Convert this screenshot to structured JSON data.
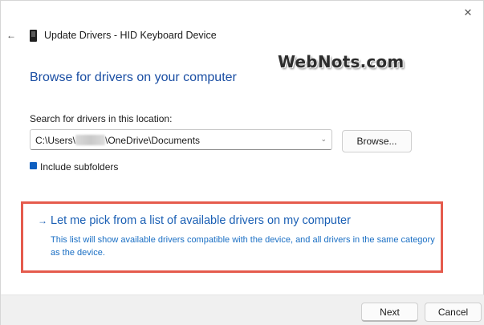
{
  "window": {
    "title": "Update Drivers - HID Keyboard Device",
    "close_glyph": "✕",
    "back_glyph": "←",
    "device_icon": "keyboard-device-icon"
  },
  "watermark": "WebNots.com",
  "main": {
    "heading": "Browse for drivers on your computer",
    "search_label": "Search for drivers in this location:",
    "path_prefix": "C:\\Users\\",
    "path_suffix": "\\OneDrive\\Documents",
    "browse_label": "Browse...",
    "include_subfolders_label": "Include subfolders",
    "include_subfolders_checked": true
  },
  "pick": {
    "arrow": "→",
    "link": "Let me pick from a list of available drivers on my computer",
    "description": "This list will show available drivers compatible with the device, and all drivers in the same category as the device."
  },
  "footer": {
    "next_label": "Next",
    "cancel_label": "Cancel"
  },
  "colors": {
    "accent": "#1a5fb4",
    "highlight_border": "#e55b4d",
    "heading": "#1a4ea3"
  }
}
